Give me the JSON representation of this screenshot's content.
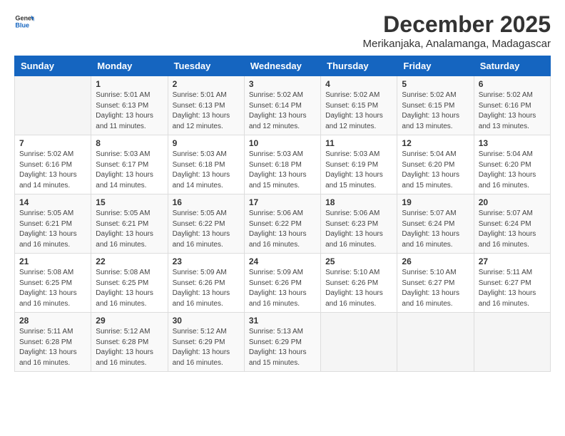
{
  "logo": {
    "line1": "General",
    "line2": "Blue"
  },
  "title": "December 2025",
  "location": "Merikanjaka, Analamanga, Madagascar",
  "days_of_week": [
    "Sunday",
    "Monday",
    "Tuesday",
    "Wednesday",
    "Thursday",
    "Friday",
    "Saturday"
  ],
  "weeks": [
    [
      {
        "day": "",
        "info": ""
      },
      {
        "day": "1",
        "info": "Sunrise: 5:01 AM\nSunset: 6:13 PM\nDaylight: 13 hours\nand 11 minutes."
      },
      {
        "day": "2",
        "info": "Sunrise: 5:01 AM\nSunset: 6:13 PM\nDaylight: 13 hours\nand 12 minutes."
      },
      {
        "day": "3",
        "info": "Sunrise: 5:02 AM\nSunset: 6:14 PM\nDaylight: 13 hours\nand 12 minutes."
      },
      {
        "day": "4",
        "info": "Sunrise: 5:02 AM\nSunset: 6:15 PM\nDaylight: 13 hours\nand 12 minutes."
      },
      {
        "day": "5",
        "info": "Sunrise: 5:02 AM\nSunset: 6:15 PM\nDaylight: 13 hours\nand 13 minutes."
      },
      {
        "day": "6",
        "info": "Sunrise: 5:02 AM\nSunset: 6:16 PM\nDaylight: 13 hours\nand 13 minutes."
      }
    ],
    [
      {
        "day": "7",
        "info": "Sunrise: 5:02 AM\nSunset: 6:16 PM\nDaylight: 13 hours\nand 14 minutes."
      },
      {
        "day": "8",
        "info": "Sunrise: 5:03 AM\nSunset: 6:17 PM\nDaylight: 13 hours\nand 14 minutes."
      },
      {
        "day": "9",
        "info": "Sunrise: 5:03 AM\nSunset: 6:18 PM\nDaylight: 13 hours\nand 14 minutes."
      },
      {
        "day": "10",
        "info": "Sunrise: 5:03 AM\nSunset: 6:18 PM\nDaylight: 13 hours\nand 15 minutes."
      },
      {
        "day": "11",
        "info": "Sunrise: 5:03 AM\nSunset: 6:19 PM\nDaylight: 13 hours\nand 15 minutes."
      },
      {
        "day": "12",
        "info": "Sunrise: 5:04 AM\nSunset: 6:20 PM\nDaylight: 13 hours\nand 15 minutes."
      },
      {
        "day": "13",
        "info": "Sunrise: 5:04 AM\nSunset: 6:20 PM\nDaylight: 13 hours\nand 16 minutes."
      }
    ],
    [
      {
        "day": "14",
        "info": "Sunrise: 5:05 AM\nSunset: 6:21 PM\nDaylight: 13 hours\nand 16 minutes."
      },
      {
        "day": "15",
        "info": "Sunrise: 5:05 AM\nSunset: 6:21 PM\nDaylight: 13 hours\nand 16 minutes."
      },
      {
        "day": "16",
        "info": "Sunrise: 5:05 AM\nSunset: 6:22 PM\nDaylight: 13 hours\nand 16 minutes."
      },
      {
        "day": "17",
        "info": "Sunrise: 5:06 AM\nSunset: 6:22 PM\nDaylight: 13 hours\nand 16 minutes."
      },
      {
        "day": "18",
        "info": "Sunrise: 5:06 AM\nSunset: 6:23 PM\nDaylight: 13 hours\nand 16 minutes."
      },
      {
        "day": "19",
        "info": "Sunrise: 5:07 AM\nSunset: 6:24 PM\nDaylight: 13 hours\nand 16 minutes."
      },
      {
        "day": "20",
        "info": "Sunrise: 5:07 AM\nSunset: 6:24 PM\nDaylight: 13 hours\nand 16 minutes."
      }
    ],
    [
      {
        "day": "21",
        "info": "Sunrise: 5:08 AM\nSunset: 6:25 PM\nDaylight: 13 hours\nand 16 minutes."
      },
      {
        "day": "22",
        "info": "Sunrise: 5:08 AM\nSunset: 6:25 PM\nDaylight: 13 hours\nand 16 minutes."
      },
      {
        "day": "23",
        "info": "Sunrise: 5:09 AM\nSunset: 6:26 PM\nDaylight: 13 hours\nand 16 minutes."
      },
      {
        "day": "24",
        "info": "Sunrise: 5:09 AM\nSunset: 6:26 PM\nDaylight: 13 hours\nand 16 minutes."
      },
      {
        "day": "25",
        "info": "Sunrise: 5:10 AM\nSunset: 6:26 PM\nDaylight: 13 hours\nand 16 minutes."
      },
      {
        "day": "26",
        "info": "Sunrise: 5:10 AM\nSunset: 6:27 PM\nDaylight: 13 hours\nand 16 minutes."
      },
      {
        "day": "27",
        "info": "Sunrise: 5:11 AM\nSunset: 6:27 PM\nDaylight: 13 hours\nand 16 minutes."
      }
    ],
    [
      {
        "day": "28",
        "info": "Sunrise: 5:11 AM\nSunset: 6:28 PM\nDaylight: 13 hours\nand 16 minutes."
      },
      {
        "day": "29",
        "info": "Sunrise: 5:12 AM\nSunset: 6:28 PM\nDaylight: 13 hours\nand 16 minutes."
      },
      {
        "day": "30",
        "info": "Sunrise: 5:12 AM\nSunset: 6:29 PM\nDaylight: 13 hours\nand 16 minutes."
      },
      {
        "day": "31",
        "info": "Sunrise: 5:13 AM\nSunset: 6:29 PM\nDaylight: 13 hours\nand 15 minutes."
      },
      {
        "day": "",
        "info": ""
      },
      {
        "day": "",
        "info": ""
      },
      {
        "day": "",
        "info": ""
      }
    ]
  ]
}
